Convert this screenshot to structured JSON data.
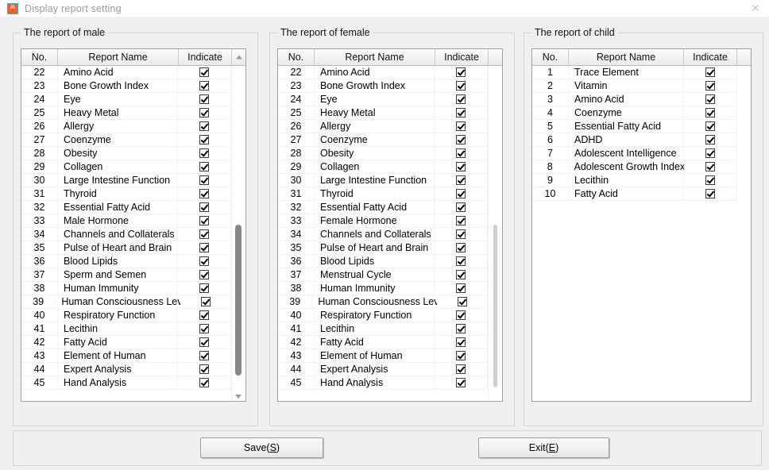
{
  "window": {
    "title": "Display report setting",
    "icon": "app-icon",
    "close_label": "✕"
  },
  "columns": {
    "no": "No.",
    "name": "Report Name",
    "indicate": "Indicate"
  },
  "groups": [
    {
      "key": "male",
      "legend": "The report of male",
      "has_scrollbar": true,
      "scroll_up_arrow": true,
      "scroll_down_arrow": true,
      "rows": [
        {
          "no": "22",
          "name": "Amino Acid",
          "checked": true
        },
        {
          "no": "23",
          "name": "Bone Growth Index",
          "checked": true
        },
        {
          "no": "24",
          "name": "Eye",
          "checked": true
        },
        {
          "no": "25",
          "name": "Heavy Metal",
          "checked": true
        },
        {
          "no": "26",
          "name": "Allergy",
          "checked": true
        },
        {
          "no": "27",
          "name": "Coenzyme",
          "checked": true
        },
        {
          "no": "28",
          "name": "Obesity",
          "checked": true
        },
        {
          "no": "29",
          "name": "Collagen",
          "checked": true
        },
        {
          "no": "30",
          "name": "Large Intestine Function",
          "checked": true
        },
        {
          "no": "31",
          "name": "Thyroid",
          "checked": true
        },
        {
          "no": "32",
          "name": "Essential Fatty Acid",
          "checked": true
        },
        {
          "no": "33",
          "name": "Male Hormone",
          "checked": true
        },
        {
          "no": "34",
          "name": "Channels and Collaterals",
          "checked": true
        },
        {
          "no": "35",
          "name": "Pulse of Heart and Brain",
          "checked": true
        },
        {
          "no": "36",
          "name": "Blood Lipids",
          "checked": true
        },
        {
          "no": "37",
          "name": "Sperm and Semen",
          "checked": true
        },
        {
          "no": "38",
          "name": "Human Immunity",
          "checked": true
        },
        {
          "no": "39",
          "name": "Human Consciousness Leve",
          "checked": true
        },
        {
          "no": "40",
          "name": "Respiratory Function",
          "checked": true
        },
        {
          "no": "41",
          "name": "Lecithin",
          "checked": true
        },
        {
          "no": "42",
          "name": "Fatty Acid",
          "checked": true
        },
        {
          "no": "43",
          "name": "Element of Human",
          "checked": true
        },
        {
          "no": "44",
          "name": "Expert Analysis",
          "checked": true
        },
        {
          "no": "45",
          "name": "Hand Analysis",
          "checked": true
        }
      ]
    },
    {
      "key": "female",
      "legend": "The report of female",
      "has_scrollbar": true,
      "scroll_up_arrow": false,
      "scroll_down_arrow": false,
      "rows": [
        {
          "no": "22",
          "name": "Amino Acid",
          "checked": true
        },
        {
          "no": "23",
          "name": "Bone Growth Index",
          "checked": true
        },
        {
          "no": "24",
          "name": "Eye",
          "checked": true
        },
        {
          "no": "25",
          "name": "Heavy Metal",
          "checked": true
        },
        {
          "no": "26",
          "name": "Allergy",
          "checked": true
        },
        {
          "no": "27",
          "name": "Coenzyme",
          "checked": true
        },
        {
          "no": "28",
          "name": "Obesity",
          "checked": true
        },
        {
          "no": "29",
          "name": "Collagen",
          "checked": true
        },
        {
          "no": "30",
          "name": "Large Intestine Function",
          "checked": true
        },
        {
          "no": "31",
          "name": "Thyroid",
          "checked": true
        },
        {
          "no": "32",
          "name": "Essential Fatty Acid",
          "checked": true
        },
        {
          "no": "33",
          "name": "Female Hormone",
          "checked": true
        },
        {
          "no": "34",
          "name": "Channels and Collaterals",
          "checked": true
        },
        {
          "no": "35",
          "name": "Pulse of Heart and Brain",
          "checked": true
        },
        {
          "no": "36",
          "name": "Blood Lipids",
          "checked": true
        },
        {
          "no": "37",
          "name": "Menstrual Cycle",
          "checked": true
        },
        {
          "no": "38",
          "name": "Human Immunity",
          "checked": true
        },
        {
          "no": "39",
          "name": "Human Consciousness Leve",
          "checked": true
        },
        {
          "no": "40",
          "name": "Respiratory Function",
          "checked": true
        },
        {
          "no": "41",
          "name": "Lecithin",
          "checked": true
        },
        {
          "no": "42",
          "name": "Fatty Acid",
          "checked": true
        },
        {
          "no": "43",
          "name": "Element of Human",
          "checked": true
        },
        {
          "no": "44",
          "name": "Expert Analysis",
          "checked": true
        },
        {
          "no": "45",
          "name": "Hand Analysis",
          "checked": true
        }
      ]
    },
    {
      "key": "child",
      "legend": "The report of child",
      "has_scrollbar": false,
      "scroll_up_arrow": false,
      "scroll_down_arrow": false,
      "rows": [
        {
          "no": "1",
          "name": "Trace Element",
          "checked": true
        },
        {
          "no": "2",
          "name": "Vitamin",
          "checked": true
        },
        {
          "no": "3",
          "name": "Amino Acid",
          "checked": true
        },
        {
          "no": "4",
          "name": "Coenzyme",
          "checked": true
        },
        {
          "no": "5",
          "name": "Essential Fatty Acid",
          "checked": true
        },
        {
          "no": "6",
          "name": "ADHD",
          "checked": true
        },
        {
          "no": "7",
          "name": "Adolescent Intelligence",
          "checked": true
        },
        {
          "no": "8",
          "name": "Adolescent Growth Index",
          "checked": true
        },
        {
          "no": "9",
          "name": "Lecithin",
          "checked": true
        },
        {
          "no": "10",
          "name": "Fatty Acid",
          "checked": true
        }
      ]
    }
  ],
  "buttons": {
    "save": {
      "prefix": "Save(",
      "accel": "S",
      "suffix": ")"
    },
    "exit": {
      "prefix": "Exit(",
      "accel": "E",
      "suffix": ")"
    }
  },
  "colors": {
    "window_bg": "#f0f0f0",
    "titlebar_bg": "#ffffff",
    "grid_bg": "#ffffff",
    "grid_border": "#a0a0a0",
    "header_text": "#111111",
    "title_text": "#9a9a9a",
    "scroll_thumb": "#868686"
  }
}
